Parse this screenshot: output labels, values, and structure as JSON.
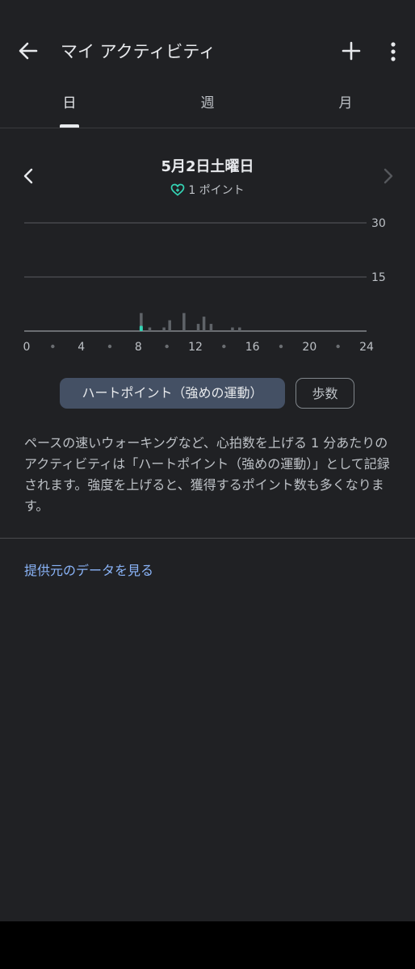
{
  "header": {
    "title": "マイ アクティビティ",
    "back_icon": "arrow-left-icon",
    "add_icon": "plus-icon",
    "more_icon": "more-vert-icon"
  },
  "tabs": [
    {
      "label": "日",
      "active": true
    },
    {
      "label": "週",
      "active": false
    },
    {
      "label": "月",
      "active": false
    }
  ],
  "date_nav": {
    "date": "5月2日土曜日",
    "points": "1 ポイント",
    "heart_icon": "heart-plus-icon",
    "accent_color": "#34d3b4"
  },
  "chart_data": {
    "type": "bar",
    "ylim": [
      0,
      30
    ],
    "yticks": [
      "30",
      "15"
    ],
    "xticks": [
      "0",
      "4",
      "8",
      "12",
      "16",
      "20",
      "24"
    ],
    "xlim": [
      0,
      24
    ],
    "bars": [
      {
        "x": 8.2,
        "value": 5,
        "highlight": false
      },
      {
        "x": 8.8,
        "value": 1,
        "highlight": false
      },
      {
        "x": 9.8,
        "value": 1,
        "highlight": false
      },
      {
        "x": 10.2,
        "value": 3,
        "highlight": false
      },
      {
        "x": 11.2,
        "value": 5,
        "highlight": false
      },
      {
        "x": 12.2,
        "value": 2,
        "highlight": false
      },
      {
        "x": 12.6,
        "value": 4,
        "highlight": false
      },
      {
        "x": 13.1,
        "value": 2,
        "highlight": false
      },
      {
        "x": 14.6,
        "value": 1,
        "highlight": false
      },
      {
        "x": 15.1,
        "value": 1,
        "highlight": false
      }
    ],
    "highlight_points": [
      {
        "x": 8.2,
        "value": 1
      }
    ],
    "bar_color": "#5f6368",
    "highlight_color": "#34d3b4"
  },
  "chips": {
    "selected": "ハートポイント（強めの運動）",
    "other": "歩数"
  },
  "description": "ペースの速いウォーキングなど、心拍数を上げる 1 分あたりのアクティビティは「ハートポイント（強めの運動）」として記録されます。強度を上げると、獲得するポイント数も多くなります。",
  "link": "提供元のデータを見る"
}
